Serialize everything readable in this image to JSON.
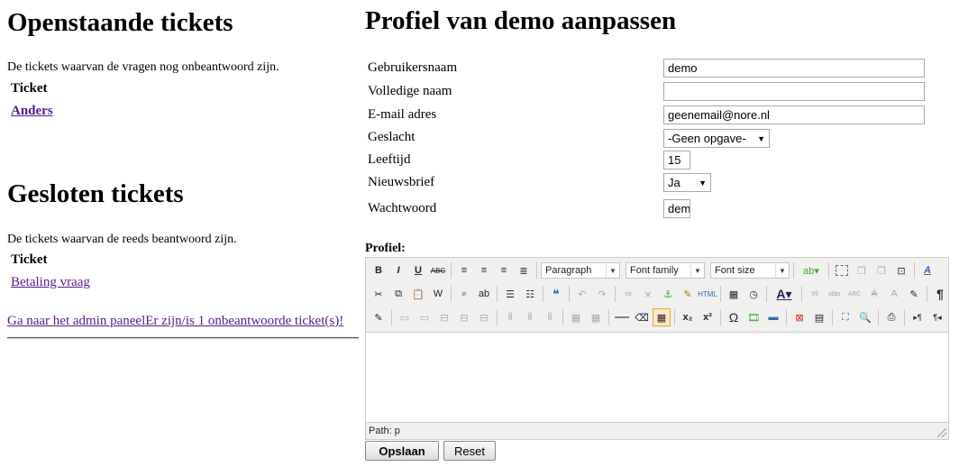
{
  "open_tickets": {
    "title": "Openstaande tickets",
    "description": "De tickets waarvan de vragen nog onbeantwoord zijn.",
    "column_header": "Ticket",
    "items": [
      "Anders"
    ]
  },
  "closed_tickets": {
    "title": "Gesloten tickets",
    "description": "De tickets waarvan de reeds beantwoord zijn.",
    "column_header": "Ticket",
    "items": [
      "Betaling vraag"
    ]
  },
  "admin_link": "Ga naar het admin paneelEr zijn/is 1 onbeantwoorde ticket(s)!",
  "profile": {
    "title": "Profiel van demo aanpassen",
    "fields": {
      "username": {
        "label": "Gebruikersnaam",
        "value": "demo"
      },
      "fullname": {
        "label": "Volledige naam",
        "value": ""
      },
      "email": {
        "label": "E-mail adres",
        "value": "geenemail@nore.nl"
      },
      "gender": {
        "label": "Geslacht",
        "value": "-Geen opgave-"
      },
      "age": {
        "label": "Leeftijd",
        "value": "15"
      },
      "newsletter": {
        "label": "Nieuwsbrief",
        "value": "Ja"
      },
      "password": {
        "label": "Wachtwoord",
        "value": "dem"
      }
    },
    "profile_label": "Profiel:"
  },
  "editor": {
    "format_dropdown": "Paragraph",
    "font_family_dropdown": "Font family",
    "font_size_dropdown": "Font size",
    "path": "Path: p"
  },
  "buttons": {
    "save": "Opslaan",
    "reset": "Reset"
  }
}
